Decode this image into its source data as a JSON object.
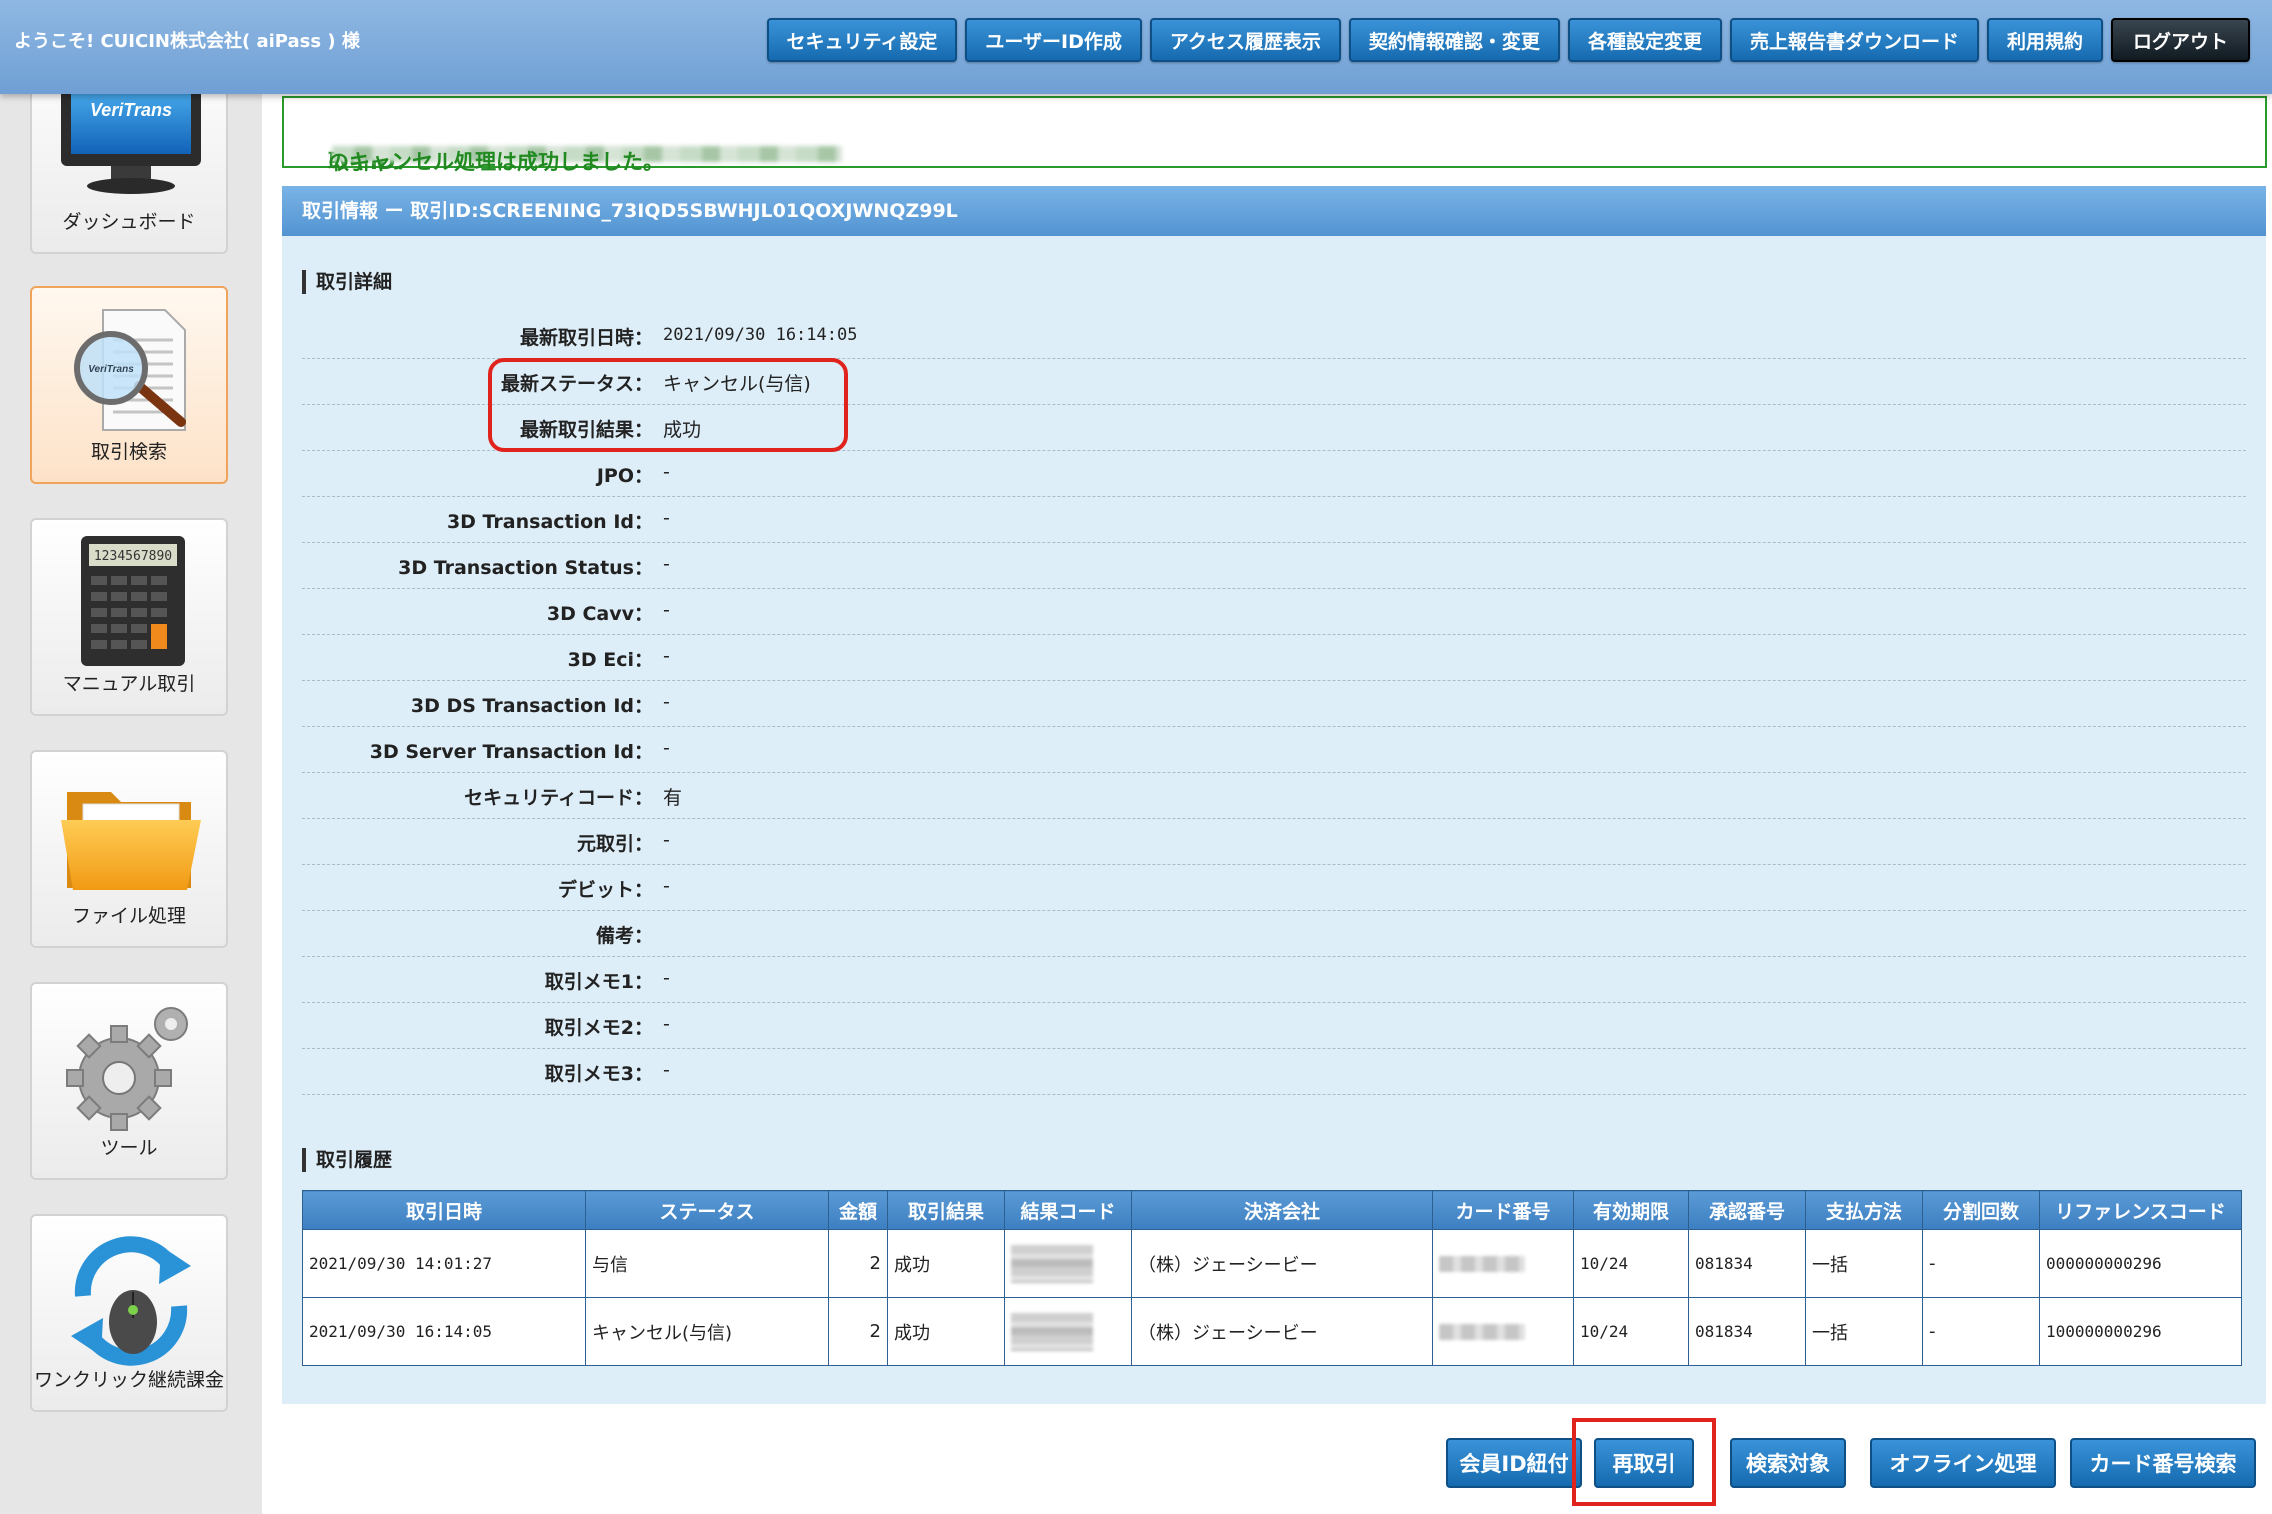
{
  "header": {
    "welcome": "ようこそ! CUICIN株式会社( aiPass ) 様",
    "nav": [
      {
        "label": "セキュリティ設定"
      },
      {
        "label": "ユーザーID作成"
      },
      {
        "label": "アクセス履歴表示"
      },
      {
        "label": "契約情報確認・変更"
      },
      {
        "label": "各種設定変更"
      },
      {
        "label": "売上報告書ダウンロード"
      },
      {
        "label": "利用規約"
      }
    ],
    "logout": "ログアウト"
  },
  "sidebar": {
    "items": [
      {
        "label": "ダッシュボード",
        "icon": "monitor-icon"
      },
      {
        "label": "取引検索",
        "icon": "magnifier-document-icon",
        "active": true
      },
      {
        "label": "マニュアル取引",
        "icon": "calculator-icon"
      },
      {
        "label": "ファイル処理",
        "icon": "folder-icon"
      },
      {
        "label": "ツール",
        "icon": "gear-icon"
      },
      {
        "label": "ワンクリック継続課金",
        "icon": "refresh-mouse-icon"
      }
    ],
    "monitor_text": "VeriTrans",
    "doc_text": "VeriTrans",
    "calc_display": "1234567890"
  },
  "message": {
    "prefix": "取引ID：",
    "suffix": "のキャンセル処理は成功しました。"
  },
  "panel": {
    "title": "取引情報 ー 取引ID:SCREENING_73IQD5SBWHJL01QOXJWNQZ99L",
    "detail_heading": "取引詳細",
    "history_heading": "取引履歴"
  },
  "details": [
    {
      "key": "最新取引日時：",
      "value": "2021/09/30 16:14:05",
      "mono": true
    },
    {
      "key": "最新ステータス：",
      "value": "キャンセル(与信)"
    },
    {
      "key": "最新取引結果：",
      "value": "成功"
    },
    {
      "key": "JPO：",
      "value": "-"
    },
    {
      "key": "3D Transaction Id：",
      "value": "-"
    },
    {
      "key": "3D Transaction Status：",
      "value": "-"
    },
    {
      "key": "3D Cavv：",
      "value": "-"
    },
    {
      "key": "3D Eci：",
      "value": "-"
    },
    {
      "key": "3D DS Transaction Id：",
      "value": "-"
    },
    {
      "key": "3D Server Transaction Id：",
      "value": "-"
    },
    {
      "key": "セキュリティコード：",
      "value": "有"
    },
    {
      "key": "元取引：",
      "value": "-"
    },
    {
      "key": "デビット：",
      "value": "-"
    },
    {
      "key": "備考：",
      "value": ""
    },
    {
      "key": "取引メモ1：",
      "value": "-"
    },
    {
      "key": "取引メモ2：",
      "value": "-"
    },
    {
      "key": "取引メモ3：",
      "value": "-"
    }
  ],
  "history": {
    "columns": [
      "取引日時",
      "ステータス",
      "金額",
      "取引結果",
      "結果コード",
      "決済会社",
      "カード番号",
      "有効期限",
      "承認番号",
      "支払方法",
      "分割回数",
      "リファレンスコード"
    ],
    "rows": [
      {
        "date": "2021/09/30 14:01:27",
        "status": "与信",
        "amount": "2",
        "result": "成功",
        "company": "（株）ジェーシービー",
        "expiry": "10/24",
        "approval": "081834",
        "payment": "一括",
        "installments": "-",
        "reference": "000000000296"
      },
      {
        "date": "2021/09/30 16:14:05",
        "status": "キャンセル(与信)",
        "amount": "2",
        "result": "成功",
        "company": "（株）ジェーシービー",
        "expiry": "10/24",
        "approval": "081834",
        "payment": "一括",
        "installments": "-",
        "reference": "100000000296"
      }
    ]
  },
  "actions": [
    {
      "label": "会員ID紐付"
    },
    {
      "label": "再取引"
    },
    {
      "label": "検索対象"
    },
    {
      "label": "オフライン処理"
    },
    {
      "label": "カード番号検索"
    }
  ],
  "colors": {
    "accent": "#1a70b5",
    "success": "#208a20",
    "highlight": "#e0241d",
    "panel": "#deeef8"
  }
}
